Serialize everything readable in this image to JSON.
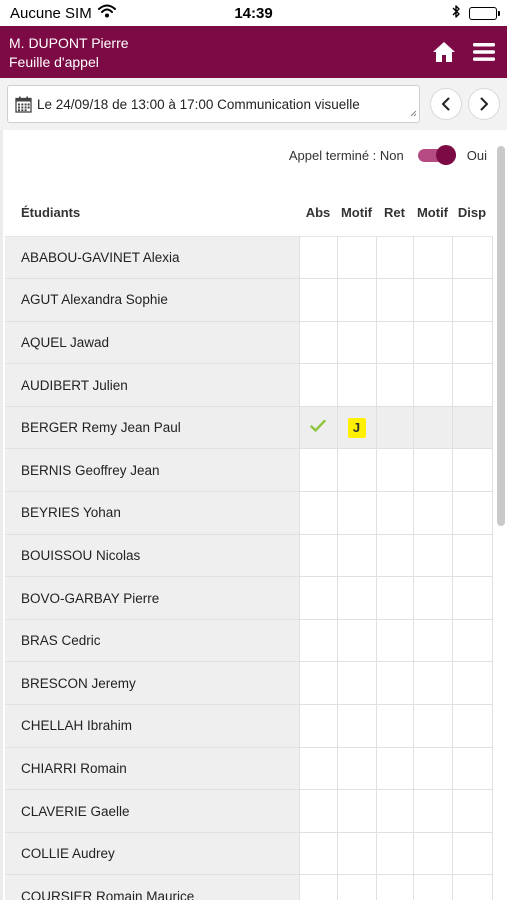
{
  "status_bar": {
    "carrier": "Aucune SIM",
    "time": "14:39"
  },
  "header": {
    "user_name": "M. DUPONT Pierre",
    "page_title": "Feuille d'appel"
  },
  "session": {
    "label": "Le 24/09/18 de 13:00 à 17:00 Communication visuelle"
  },
  "toggle": {
    "label": "Appel terminé : Non",
    "on_label": "Oui"
  },
  "colors": {
    "brand": "#7c0a44",
    "check": "#8cc63f",
    "motif_badge": "#fff000"
  },
  "columns": {
    "students": "Étudiants",
    "abs": "Abs",
    "abs_motif": "Motif",
    "ret": "Ret",
    "ret_motif": "Motif",
    "disp": "Disp"
  },
  "students": [
    {
      "name": "ABABOU-GAVINET Alexia",
      "abs": false,
      "abs_motif": "",
      "ret": "",
      "ret_motif": "",
      "disp": ""
    },
    {
      "name": "AGUT Alexandra Sophie",
      "abs": false,
      "abs_motif": "",
      "ret": "",
      "ret_motif": "",
      "disp": ""
    },
    {
      "name": "AQUEL Jawad",
      "abs": false,
      "abs_motif": "",
      "ret": "",
      "ret_motif": "",
      "disp": ""
    },
    {
      "name": "AUDIBERT Julien",
      "abs": false,
      "abs_motif": "",
      "ret": "",
      "ret_motif": "",
      "disp": ""
    },
    {
      "name": "BERGER Remy Jean Paul",
      "abs": true,
      "abs_motif": "J",
      "ret": "",
      "ret_motif": "",
      "disp": ""
    },
    {
      "name": "BERNIS Geoffrey Jean",
      "abs": false,
      "abs_motif": "",
      "ret": "",
      "ret_motif": "",
      "disp": ""
    },
    {
      "name": "BEYRIES Yohan",
      "abs": false,
      "abs_motif": "",
      "ret": "",
      "ret_motif": "",
      "disp": ""
    },
    {
      "name": "BOUISSOU Nicolas",
      "abs": false,
      "abs_motif": "",
      "ret": "",
      "ret_motif": "",
      "disp": ""
    },
    {
      "name": "BOVO-GARBAY Pierre",
      "abs": false,
      "abs_motif": "",
      "ret": "",
      "ret_motif": "",
      "disp": ""
    },
    {
      "name": "BRAS Cedric",
      "abs": false,
      "abs_motif": "",
      "ret": "",
      "ret_motif": "",
      "disp": ""
    },
    {
      "name": "BRESCON Jeremy",
      "abs": false,
      "abs_motif": "",
      "ret": "",
      "ret_motif": "",
      "disp": ""
    },
    {
      "name": "CHELLAH Ibrahim",
      "abs": false,
      "abs_motif": "",
      "ret": "",
      "ret_motif": "",
      "disp": ""
    },
    {
      "name": "CHIARRI Romain",
      "abs": false,
      "abs_motif": "",
      "ret": "",
      "ret_motif": "",
      "disp": ""
    },
    {
      "name": "CLAVERIE Gaelle",
      "abs": false,
      "abs_motif": "",
      "ret": "",
      "ret_motif": "",
      "disp": ""
    },
    {
      "name": "COLLIE Audrey",
      "abs": false,
      "abs_motif": "",
      "ret": "",
      "ret_motif": "",
      "disp": ""
    },
    {
      "name": "COURSIER Romain Maurice",
      "abs": false,
      "abs_motif": "",
      "ret": "",
      "ret_motif": "",
      "disp": ""
    }
  ]
}
